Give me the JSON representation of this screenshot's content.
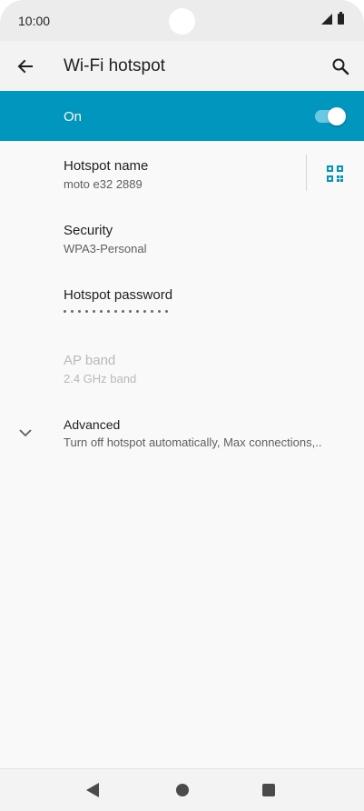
{
  "status_bar": {
    "time": "10:00"
  },
  "app_bar": {
    "title": "Wi-Fi hotspot"
  },
  "master_switch": {
    "label": "On",
    "checked": true
  },
  "preferences": {
    "hotspot_name": {
      "title": "Hotspot name",
      "summary": "moto e32 2889"
    },
    "security": {
      "title": "Security",
      "summary": "WPA3-Personal"
    },
    "password": {
      "title": "Hotspot password",
      "masked_length": 15
    },
    "ap_band": {
      "title": "AP band",
      "summary": "2.4 GHz band",
      "enabled": false
    },
    "advanced": {
      "title": "Advanced",
      "summary": "Turn off hotspot automatically, Max connections,.."
    }
  },
  "colors": {
    "accent": "#0096bd",
    "toggle_track": "#6cc8e0",
    "disabled_text": "#b9b9b9"
  },
  "icons": {
    "back": "arrow-left-icon",
    "search": "search-icon",
    "qr": "qr-code-icon",
    "expand": "chevron-down-icon"
  }
}
